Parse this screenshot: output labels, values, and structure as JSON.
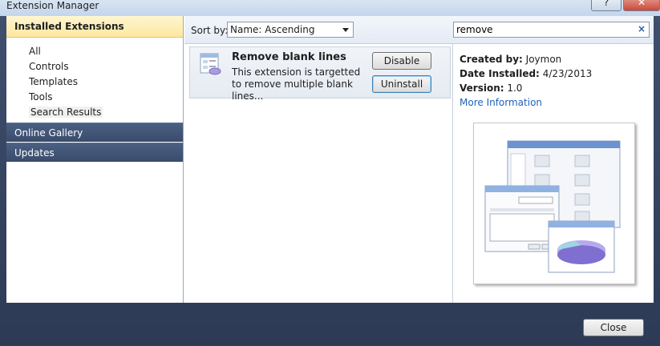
{
  "window": {
    "title": "Extension Manager",
    "help_label": "?",
    "close_label": "✕"
  },
  "sidebar": {
    "installed_header": "Installed Extensions",
    "items": [
      {
        "label": "All"
      },
      {
        "label": "Controls"
      },
      {
        "label": "Templates"
      },
      {
        "label": "Tools"
      },
      {
        "label": "Search Results"
      }
    ],
    "online_gallery": "Online Gallery",
    "updates": "Updates"
  },
  "toolbar": {
    "sort_label": "Sort by:",
    "sort_value": "Name: Ascending",
    "search_value": "remove",
    "clear_icon": "×"
  },
  "results": [
    {
      "name": "Remove blank lines",
      "description": "This extension is targetted to remove multiple blank lines...",
      "disable_label": "Disable",
      "uninstall_label": "Uninstall"
    }
  ],
  "details": {
    "created_by_label": "Created by:",
    "created_by": "Joymon",
    "date_installed_label": "Date Installed:",
    "date_installed": "4/23/2013",
    "version_label": "Version:",
    "version": "1.0",
    "more_info": "More Information"
  },
  "footer": {
    "close_label": "Close"
  },
  "colors": {
    "nav_group_bg": "#3a4c6d",
    "installed_header_bg": "#fde8a0",
    "link": "#1f62b6",
    "frame_bg": "#2d3a55"
  }
}
